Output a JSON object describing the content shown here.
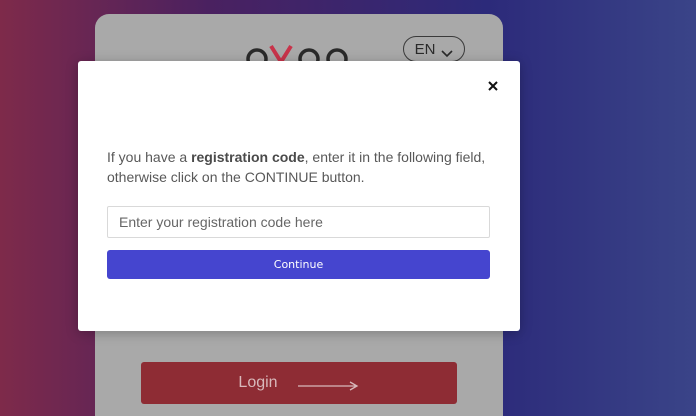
{
  "background": {
    "language": "EN",
    "login_label": "Login",
    "brand_colors": {
      "logo_dark": "#2a2a2a",
      "logo_accent": "#c8334a"
    }
  },
  "modal": {
    "message_prefix": "If you have a ",
    "message_bold": "registration code",
    "message_suffix": ", enter it in the following field, otherwise click on the CONTINUE button.",
    "input_placeholder": "Enter your registration code here",
    "input_value": "",
    "continue_label": "Continue",
    "accent_color": "#4545cf"
  }
}
